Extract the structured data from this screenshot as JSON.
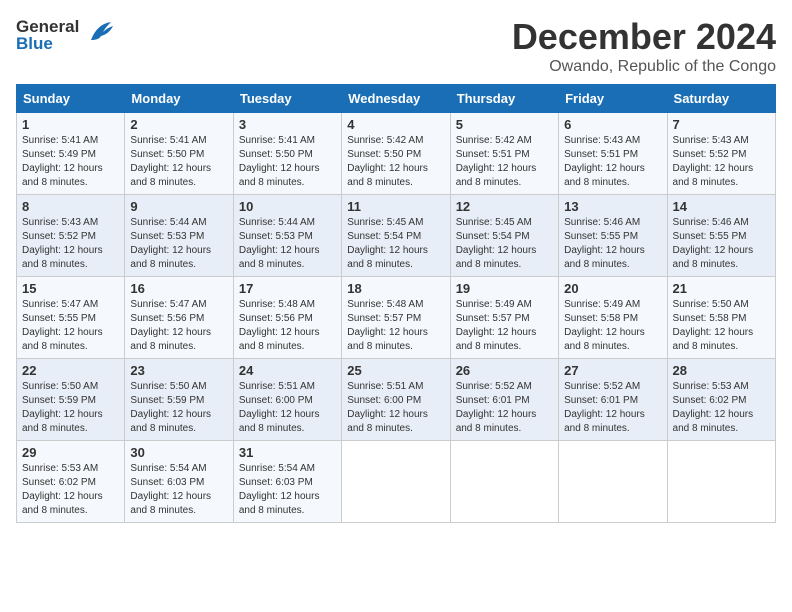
{
  "logo": {
    "part1": "General",
    "part2": "Blue"
  },
  "title": "December 2024",
  "subtitle": "Owando, Republic of the Congo",
  "days_of_week": [
    "Sunday",
    "Monday",
    "Tuesday",
    "Wednesday",
    "Thursday",
    "Friday",
    "Saturday"
  ],
  "weeks": [
    [
      {
        "day": "1",
        "sunrise": "5:41 AM",
        "sunset": "5:49 PM",
        "daylight": "12 hours and 8 minutes."
      },
      {
        "day": "2",
        "sunrise": "5:41 AM",
        "sunset": "5:50 PM",
        "daylight": "12 hours and 8 minutes."
      },
      {
        "day": "3",
        "sunrise": "5:41 AM",
        "sunset": "5:50 PM",
        "daylight": "12 hours and 8 minutes."
      },
      {
        "day": "4",
        "sunrise": "5:42 AM",
        "sunset": "5:50 PM",
        "daylight": "12 hours and 8 minutes."
      },
      {
        "day": "5",
        "sunrise": "5:42 AM",
        "sunset": "5:51 PM",
        "daylight": "12 hours and 8 minutes."
      },
      {
        "day": "6",
        "sunrise": "5:43 AM",
        "sunset": "5:51 PM",
        "daylight": "12 hours and 8 minutes."
      },
      {
        "day": "7",
        "sunrise": "5:43 AM",
        "sunset": "5:52 PM",
        "daylight": "12 hours and 8 minutes."
      }
    ],
    [
      {
        "day": "8",
        "sunrise": "5:43 AM",
        "sunset": "5:52 PM",
        "daylight": "12 hours and 8 minutes."
      },
      {
        "day": "9",
        "sunrise": "5:44 AM",
        "sunset": "5:53 PM",
        "daylight": "12 hours and 8 minutes."
      },
      {
        "day": "10",
        "sunrise": "5:44 AM",
        "sunset": "5:53 PM",
        "daylight": "12 hours and 8 minutes."
      },
      {
        "day": "11",
        "sunrise": "5:45 AM",
        "sunset": "5:54 PM",
        "daylight": "12 hours and 8 minutes."
      },
      {
        "day": "12",
        "sunrise": "5:45 AM",
        "sunset": "5:54 PM",
        "daylight": "12 hours and 8 minutes."
      },
      {
        "day": "13",
        "sunrise": "5:46 AM",
        "sunset": "5:55 PM",
        "daylight": "12 hours and 8 minutes."
      },
      {
        "day": "14",
        "sunrise": "5:46 AM",
        "sunset": "5:55 PM",
        "daylight": "12 hours and 8 minutes."
      }
    ],
    [
      {
        "day": "15",
        "sunrise": "5:47 AM",
        "sunset": "5:55 PM",
        "daylight": "12 hours and 8 minutes."
      },
      {
        "day": "16",
        "sunrise": "5:47 AM",
        "sunset": "5:56 PM",
        "daylight": "12 hours and 8 minutes."
      },
      {
        "day": "17",
        "sunrise": "5:48 AM",
        "sunset": "5:56 PM",
        "daylight": "12 hours and 8 minutes."
      },
      {
        "day": "18",
        "sunrise": "5:48 AM",
        "sunset": "5:57 PM",
        "daylight": "12 hours and 8 minutes."
      },
      {
        "day": "19",
        "sunrise": "5:49 AM",
        "sunset": "5:57 PM",
        "daylight": "12 hours and 8 minutes."
      },
      {
        "day": "20",
        "sunrise": "5:49 AM",
        "sunset": "5:58 PM",
        "daylight": "12 hours and 8 minutes."
      },
      {
        "day": "21",
        "sunrise": "5:50 AM",
        "sunset": "5:58 PM",
        "daylight": "12 hours and 8 minutes."
      }
    ],
    [
      {
        "day": "22",
        "sunrise": "5:50 AM",
        "sunset": "5:59 PM",
        "daylight": "12 hours and 8 minutes."
      },
      {
        "day": "23",
        "sunrise": "5:50 AM",
        "sunset": "5:59 PM",
        "daylight": "12 hours and 8 minutes."
      },
      {
        "day": "24",
        "sunrise": "5:51 AM",
        "sunset": "6:00 PM",
        "daylight": "12 hours and 8 minutes."
      },
      {
        "day": "25",
        "sunrise": "5:51 AM",
        "sunset": "6:00 PM",
        "daylight": "12 hours and 8 minutes."
      },
      {
        "day": "26",
        "sunrise": "5:52 AM",
        "sunset": "6:01 PM",
        "daylight": "12 hours and 8 minutes."
      },
      {
        "day": "27",
        "sunrise": "5:52 AM",
        "sunset": "6:01 PM",
        "daylight": "12 hours and 8 minutes."
      },
      {
        "day": "28",
        "sunrise": "5:53 AM",
        "sunset": "6:02 PM",
        "daylight": "12 hours and 8 minutes."
      }
    ],
    [
      {
        "day": "29",
        "sunrise": "5:53 AM",
        "sunset": "6:02 PM",
        "daylight": "12 hours and 8 minutes."
      },
      {
        "day": "30",
        "sunrise": "5:54 AM",
        "sunset": "6:03 PM",
        "daylight": "12 hours and 8 minutes."
      },
      {
        "day": "31",
        "sunrise": "5:54 AM",
        "sunset": "6:03 PM",
        "daylight": "12 hours and 8 minutes."
      },
      null,
      null,
      null,
      null
    ]
  ]
}
